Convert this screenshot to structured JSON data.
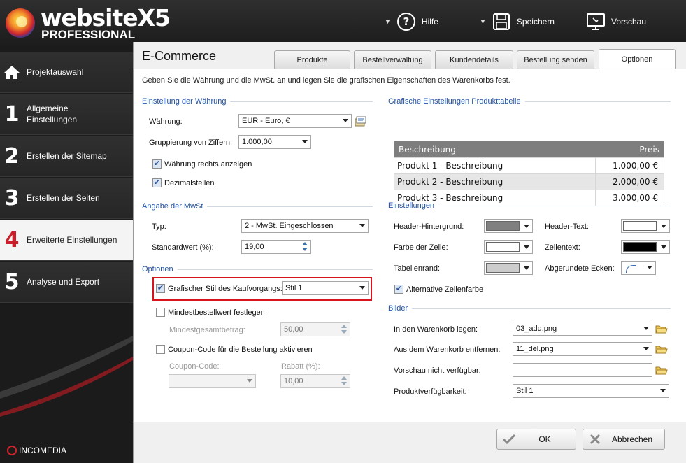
{
  "app": {
    "logo": "websiteX5",
    "logo_suffix": "5",
    "edition": "PROFESSIONAL",
    "vendor": "INCOMEDIA"
  },
  "toolbar": {
    "help": "Hilfe",
    "save": "Speichern",
    "preview": "Vorschau"
  },
  "sidebar": {
    "items": [
      {
        "num": "",
        "label": "Projektauswahl",
        "icon": "home-icon"
      },
      {
        "num": "1",
        "label": "Allgemeine Einstellungen"
      },
      {
        "num": "2",
        "label": "Erstellen der Sitemap"
      },
      {
        "num": "3",
        "label": "Erstellen der Seiten"
      },
      {
        "num": "4",
        "label": "Erweiterte Einstellungen",
        "active": true
      },
      {
        "num": "5",
        "label": "Analyse und Export"
      }
    ]
  },
  "dialog": {
    "title": "E-Commerce",
    "tabs": [
      "Produkte",
      "Bestellverwaltung",
      "Kundendetails",
      "Bestellung senden",
      "Optionen"
    ],
    "active_tab": "Optionen",
    "description": "Geben Sie die Währung und die MwSt. an und legen Sie die grafischen Eigenschaften des Warenkorbs fest.",
    "currency": {
      "section": "Einstellung der Währung",
      "currency_label": "Währung:",
      "currency_value": "EUR - Euro, €",
      "grouping_label": "Gruppierung von Ziffern:",
      "grouping_value": "1.000,00",
      "right_label": "Währung rechts anzeigen",
      "right_checked": true,
      "decimals_label": "Dezimalstellen",
      "decimals_checked": true
    },
    "vat": {
      "section": "Angabe der MwSt",
      "type_label": "Typ:",
      "type_value": "2 - MwSt. Eingeschlossen",
      "default_label": "Standardwert (%):",
      "default_value": "19,00"
    },
    "options": {
      "section": "Optionen",
      "style_label": "Grafischer Stil des Kaufvorgangs:",
      "style_checked": true,
      "style_value": "Stil 1",
      "min_order_label": "Mindestbestellwert festlegen",
      "min_total_label": "Mindestgesamtbetrag:",
      "min_total_value": "50,00",
      "coupon_label": "Coupon-Code für die Bestellung aktivieren",
      "coupon_code_label": "Coupon-Code:",
      "discount_label": "Rabatt (%):",
      "discount_value": "10,00"
    },
    "product_table": {
      "section": "Grafische Einstellungen Produkttabelle",
      "col_desc": "Beschreibung",
      "col_price": "Preis",
      "rows": [
        {
          "desc": "Produkt 1 - Beschreibung",
          "price": "1.000,00 €"
        },
        {
          "desc": "Produkt 2 - Beschreibung",
          "price": "2.000,00 €"
        },
        {
          "desc": "Produkt 3 - Beschreibung",
          "price": "3.000,00 €"
        }
      ]
    },
    "settings": {
      "section": "Einstellungen",
      "header_bg_label": "Header-Hintergrund:",
      "header_bg_color": "#808080",
      "header_text_label": "Header-Text:",
      "header_text_color": "#ffffff",
      "cell_color_label": "Farbe der Zelle:",
      "cell_color": "#ffffff",
      "cell_text_label": "Zellentext:",
      "cell_text_color": "#000000",
      "border_label": "Tabellenrand:",
      "border_color": "#cccccc",
      "rounded_label": "Abgerundete Ecken:",
      "alt_row_label": "Alternative Zeilenfarbe",
      "alt_row_checked": true
    },
    "images": {
      "section": "Bilder",
      "add_label": "In den Warenkorb legen:",
      "add_value": "03_add.png",
      "remove_label": "Aus dem Warenkorb entfernen:",
      "remove_value": "11_del.png",
      "preview_label": "Vorschau nicht verfügbar:",
      "preview_value": "",
      "availability_label": "Produktverfügbarkeit:",
      "availability_value": "Stil 1"
    },
    "buttons": {
      "ok": "OK",
      "cancel": "Abbrechen"
    }
  }
}
